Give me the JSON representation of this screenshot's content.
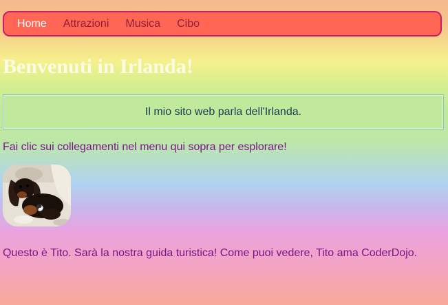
{
  "nav": {
    "items": [
      {
        "label": "Home",
        "active": true
      },
      {
        "label": "Attrazioni",
        "active": false
      },
      {
        "label": "Musica",
        "active": false
      },
      {
        "label": "Cibo",
        "active": false
      }
    ]
  },
  "page": {
    "title": "Benvenuti in Irlanda!",
    "intro": "Il mio sito web parla dell'Irlanda.",
    "instruction": "Fai clic sui collegamenti nel menu qui sopra per esplorare!",
    "caption": "Questo è Tito. Sarà la nostra guida turistica! Come puoi vedere, Tito ama CoderDojo."
  },
  "colors": {
    "nav_background": "#ff6653",
    "nav_border": "#c81e6a",
    "nav_active_text": "#ffffff",
    "nav_text": "#8e1f3a",
    "title_text": "#fbfbe4",
    "intro_background": "#c1e99c",
    "body_text": "#7a1682"
  }
}
